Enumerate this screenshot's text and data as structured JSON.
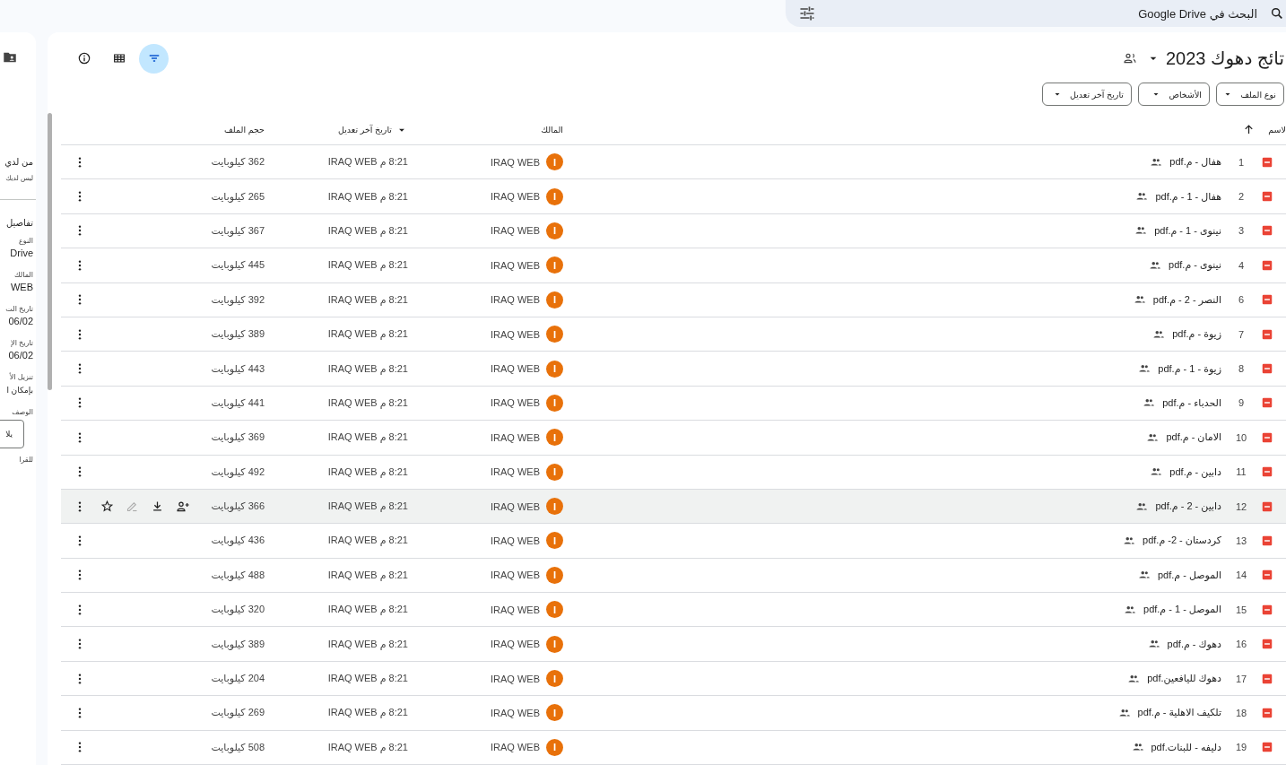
{
  "search": {
    "placeholder": "البحث في Google Drive"
  },
  "details_panel": {
    "access_title": "من لدي",
    "access_text": "ليس لديك",
    "section_title": "تفاصيل",
    "fields": [
      {
        "label": "النوع",
        "value": "Drive"
      },
      {
        "label": "المالك",
        "value": "WEB"
      },
      {
        "label": "تاريخ الت",
        "value": "06/02"
      },
      {
        "label": "تاريخ الإ",
        "value": "06/02"
      },
      {
        "label": "تنزيل الأ",
        "value": "بإمكان ا"
      }
    ],
    "description_label": "الوصف",
    "description_value": "يلا",
    "description_hint": "للقرا"
  },
  "folder": {
    "title": "تائج دهوك 2023"
  },
  "filters": [
    {
      "label": "نوع الملف"
    },
    {
      "label": "الأشخاص"
    },
    {
      "label": "تاريخ آخر تعديل"
    }
  ],
  "view": {
    "filter_active": true
  },
  "columns": {
    "name": "لاسم",
    "owner": "المالك",
    "modified": "تاريخ آخر تعديل",
    "size": "حجم الملف"
  },
  "rows": [
    {
      "number": "1",
      "name": "هفال - م.pdf",
      "owner": "IRAQ WEB",
      "avatar": "I",
      "modified": "8:21 م IRAQ WEB",
      "size": "362 كيلوبايت",
      "hovered": false
    },
    {
      "number": "2",
      "name": "هفال - 1 - م.pdf",
      "owner": "IRAQ WEB",
      "avatar": "I",
      "modified": "8:21 م IRAQ WEB",
      "size": "265 كيلوبايت",
      "hovered": false
    },
    {
      "number": "3",
      "name": "نينوى - 1 - م.pdf",
      "owner": "IRAQ WEB",
      "avatar": "I",
      "modified": "8:21 م IRAQ WEB",
      "size": "367 كيلوبايت",
      "hovered": false
    },
    {
      "number": "4",
      "name": "نينوى - م.pdf",
      "owner": "IRAQ WEB",
      "avatar": "I",
      "modified": "8:21 م IRAQ WEB",
      "size": "445 كيلوبايت",
      "hovered": false
    },
    {
      "number": "6",
      "name": "النصر - 2 - م.pdf",
      "owner": "IRAQ WEB",
      "avatar": "I",
      "modified": "8:21 م IRAQ WEB",
      "size": "392 كيلوبايت",
      "hovered": false
    },
    {
      "number": "7",
      "name": "زيوة - م.pdf",
      "owner": "IRAQ WEB",
      "avatar": "I",
      "modified": "8:21 م IRAQ WEB",
      "size": "389 كيلوبايت",
      "hovered": false
    },
    {
      "number": "8",
      "name": "زيوة - 1 - م.pdf",
      "owner": "IRAQ WEB",
      "avatar": "I",
      "modified": "8:21 م IRAQ WEB",
      "size": "443 كيلوبايت",
      "hovered": false
    },
    {
      "number": "9",
      "name": "الحدباء - م.pdf",
      "owner": "IRAQ WEB",
      "avatar": "I",
      "modified": "8:21 م IRAQ WEB",
      "size": "441 كيلوبايت",
      "hovered": false
    },
    {
      "number": "10",
      "name": "الامان - م.pdf",
      "owner": "IRAQ WEB",
      "avatar": "I",
      "modified": "8:21 م IRAQ WEB",
      "size": "369 كيلوبايت",
      "hovered": false
    },
    {
      "number": "11",
      "name": "دابين - م.pdf",
      "owner": "IRAQ WEB",
      "avatar": "I",
      "modified": "8:21 م IRAQ WEB",
      "size": "492 كيلوبايت",
      "hovered": false
    },
    {
      "number": "12",
      "name": "دابين - 2 - م.pdf",
      "owner": "IRAQ WEB",
      "avatar": "I",
      "modified": "8:21 م IRAQ WEB",
      "size": "366 كيلوبايت",
      "hovered": true
    },
    {
      "number": "13",
      "name": "كردستان - 2- م.pdf",
      "owner": "IRAQ WEB",
      "avatar": "I",
      "modified": "8:21 م IRAQ WEB",
      "size": "436 كيلوبايت",
      "hovered": false
    },
    {
      "number": "14",
      "name": "الموصل - م.pdf",
      "owner": "IRAQ WEB",
      "avatar": "I",
      "modified": "8:21 م IRAQ WEB",
      "size": "488 كيلوبايت",
      "hovered": false
    },
    {
      "number": "15",
      "name": "الموصل - 1 - م.pdf",
      "owner": "IRAQ WEB",
      "avatar": "I",
      "modified": "8:21 م IRAQ WEB",
      "size": "320 كيلوبايت",
      "hovered": false
    },
    {
      "number": "16",
      "name": "دهوك - م.pdf",
      "owner": "IRAQ WEB",
      "avatar": "I",
      "modified": "8:21 م IRAQ WEB",
      "size": "389 كيلوبايت",
      "hovered": false
    },
    {
      "number": "17",
      "name": "دهوك لليافعين.pdf",
      "owner": "IRAQ WEB",
      "avatar": "I",
      "modified": "8:21 م IRAQ WEB",
      "size": "204 كيلوبايت",
      "hovered": false
    },
    {
      "number": "18",
      "name": "تلكيف الاهلية - م.pdf",
      "owner": "IRAQ WEB",
      "avatar": "I",
      "modified": "8:21 م IRAQ WEB",
      "size": "269 كيلوبايت",
      "hovered": false
    },
    {
      "number": "19",
      "name": "دليفه - للبنات.pdf",
      "owner": "IRAQ WEB",
      "avatar": "I",
      "modified": "8:21 م IRAQ WEB",
      "size": "508 كيلوبايت",
      "hovered": false
    }
  ]
}
